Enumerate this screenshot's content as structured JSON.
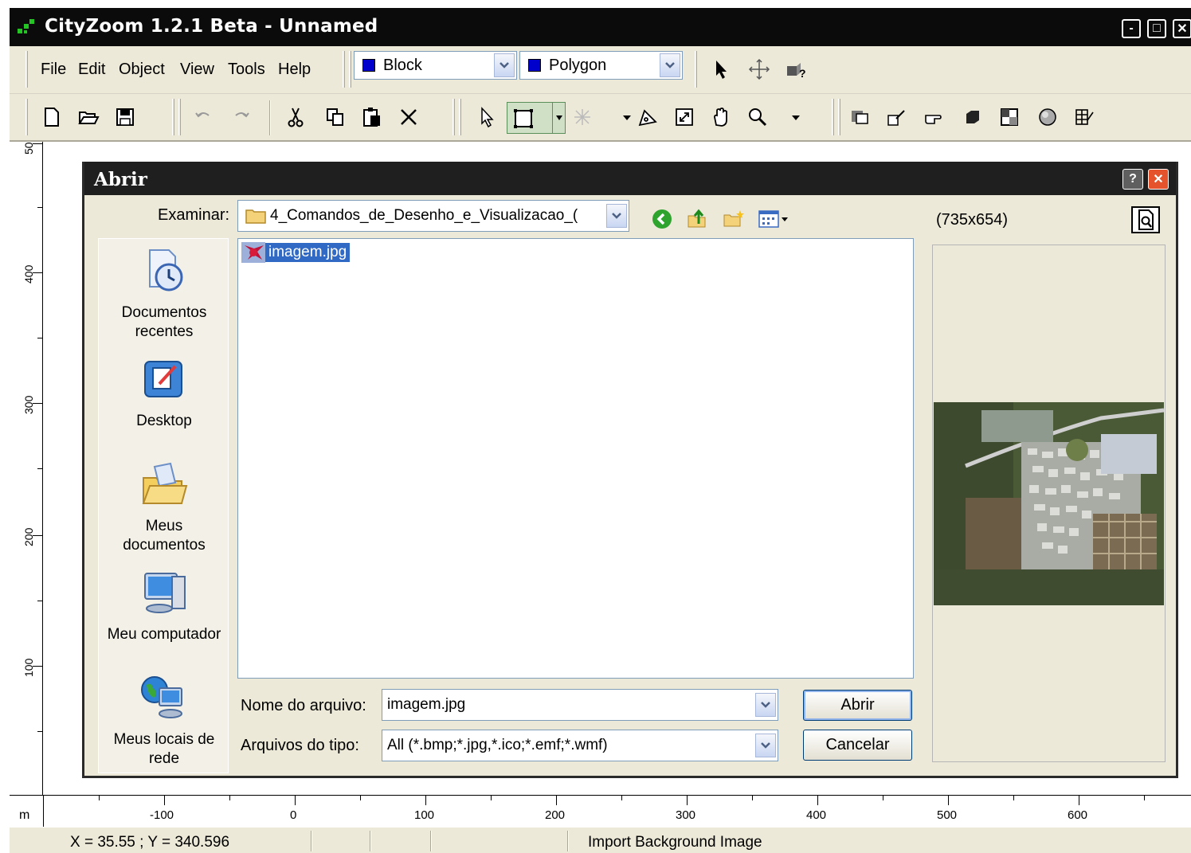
{
  "window": {
    "title": "CityZoom 1.2.1 Beta - Unnamed",
    "controls": [
      "-",
      "□",
      "✕"
    ]
  },
  "menu": {
    "items": [
      "File",
      "Edit",
      "Object",
      "View",
      "Tools",
      "Help"
    ]
  },
  "layer_combo": {
    "value": "Block",
    "color": "#0000cc"
  },
  "shape_combo": {
    "value": "Polygon",
    "color": "#0000cc"
  },
  "rulers": {
    "unit": "m",
    "vertical_labels": [
      "50",
      "400",
      "300",
      "200",
      "100"
    ],
    "horizontal_labels": [
      "-100",
      "0",
      "100",
      "200",
      "300",
      "400",
      "500",
      "600"
    ]
  },
  "status": {
    "coords": "X = 35.55 ;  Y = 340.596",
    "message": "Import Background Image"
  },
  "dialog": {
    "title": "Abrir",
    "help_button": "?",
    "close_button": "✕",
    "look_in_label": "Examinar:",
    "look_in_value": "4_Comandos_de_Desenho_e_Visualizacao_(",
    "preview_size": "(735x654)",
    "places": [
      {
        "label": "Documentos recentes",
        "icon": "recent-documents-icon"
      },
      {
        "label": "Desktop",
        "icon": "desktop-icon"
      },
      {
        "label": "Meus documentos",
        "icon": "my-documents-icon"
      },
      {
        "label": "Meu computador",
        "icon": "my-computer-icon"
      },
      {
        "label": "Meus locais de rede",
        "icon": "network-places-icon"
      }
    ],
    "files": [
      {
        "name": "imagem.jpg",
        "selected": true
      }
    ],
    "filename_label": "Nome do arquivo:",
    "filename_value": "imagem.jpg",
    "filetype_label": "Arquivos do tipo:",
    "filetype_value": "All (*.bmp;*.jpg,*.ico;*.emf;*.wmf)",
    "open_button": "Abrir",
    "cancel_button": "Cancelar"
  }
}
